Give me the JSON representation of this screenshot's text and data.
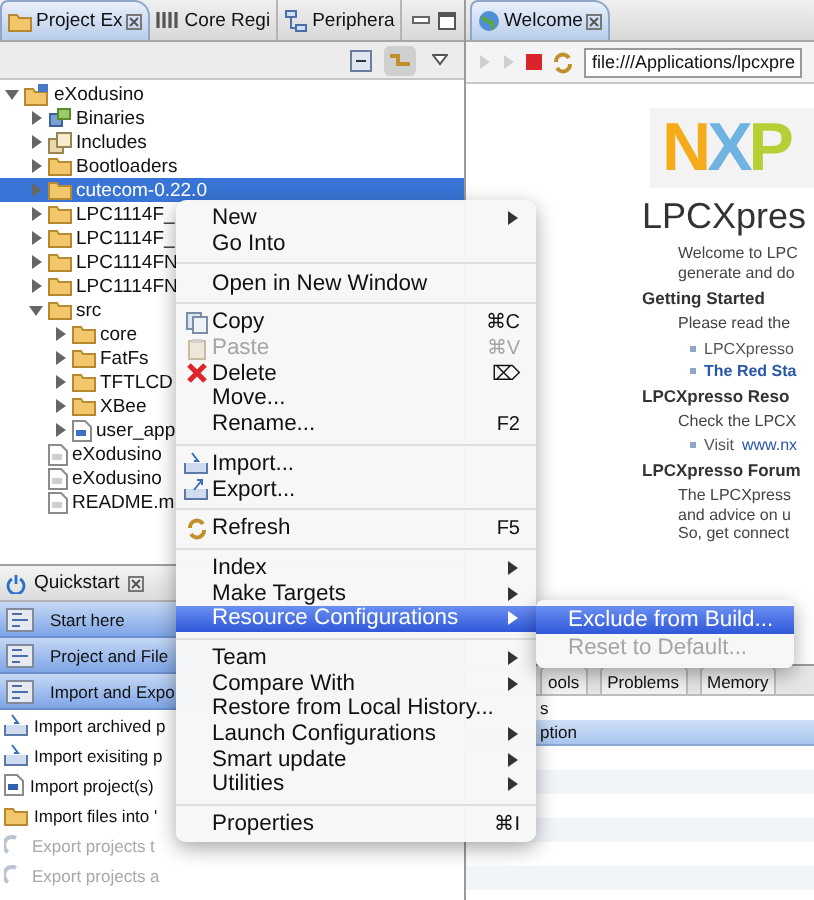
{
  "left_tabs": [
    {
      "label": "Project Ex",
      "selected": true
    },
    {
      "label": "Core Regi",
      "selected": false
    },
    {
      "label": "Periphera",
      "selected": false
    }
  ],
  "tree": [
    {
      "label": "eXodusino",
      "kind": "project",
      "expanded": true,
      "selected": false,
      "children": [
        {
          "label": "Binaries",
          "kind": "binaries",
          "expanded": false,
          "selected": false
        },
        {
          "label": "Includes",
          "kind": "includes",
          "expanded": false,
          "selected": false
        },
        {
          "label": "Bootloaders",
          "kind": "folder",
          "expanded": false,
          "selected": false
        },
        {
          "label": "cutecom-0.22.0",
          "kind": "folder",
          "expanded": false,
          "selected": true
        },
        {
          "label": "LPC1114F_",
          "kind": "folder",
          "expanded": false,
          "selected": false
        },
        {
          "label": "LPC1114F_",
          "kind": "folder",
          "expanded": false,
          "selected": false
        },
        {
          "label": "LPC1114FN",
          "kind": "folder",
          "expanded": false,
          "selected": false
        },
        {
          "label": "LPC1114FN",
          "kind": "folder",
          "expanded": false,
          "selected": false
        },
        {
          "label": "src",
          "kind": "folder",
          "expanded": true,
          "selected": false,
          "children": [
            {
              "label": "core",
              "kind": "folder",
              "expanded": false,
              "selected": false
            },
            {
              "label": "FatFs",
              "kind": "folder",
              "expanded": false,
              "selected": false
            },
            {
              "label": "TFTLCD",
              "kind": "folder",
              "expanded": false,
              "selected": false
            },
            {
              "label": "XBee",
              "kind": "folder",
              "expanded": false,
              "selected": false
            },
            {
              "label": "user_app",
              "kind": "source",
              "expanded": false,
              "selected": false
            }
          ]
        },
        {
          "label": "eXodusino",
          "kind": "file",
          "selected": false
        },
        {
          "label": "eXodusino",
          "kind": "file",
          "selected": false
        },
        {
          "label": "README.m",
          "kind": "file",
          "selected": false
        }
      ]
    }
  ],
  "quickstart": {
    "title": "Quickstart",
    "items": [
      {
        "label": "Start here",
        "kind": "section",
        "disabled": false
      },
      {
        "label": "Project and File",
        "kind": "section",
        "disabled": false
      },
      {
        "label": "Import and Expo",
        "kind": "section",
        "disabled": false
      },
      {
        "label": "Import archived p",
        "kind": "action",
        "disabled": false
      },
      {
        "label": "Import exisiting p",
        "kind": "action",
        "disabled": false
      },
      {
        "label": "Import project(s)",
        "kind": "action",
        "disabled": false
      },
      {
        "label": "Import files into '",
        "kind": "action",
        "disabled": false
      },
      {
        "label": "Export projects t",
        "kind": "action",
        "disabled": true
      },
      {
        "label": "Export projects a",
        "kind": "action",
        "disabled": true
      }
    ]
  },
  "editor": {
    "tab": "Welcome",
    "url": "file:///Applications/lpcxpre",
    "logo": "NXP",
    "title": "LPCXpres",
    "blocks": [
      {
        "kind": "paragraph",
        "lines": [
          "Welcome to LPC",
          "generate and do"
        ]
      },
      {
        "kind": "heading",
        "text": "Getting Started"
      },
      {
        "kind": "paragraph",
        "lines": [
          "Please read the"
        ]
      },
      {
        "kind": "bullet",
        "text": "LPCXpresso"
      },
      {
        "kind": "bullet",
        "link": "The Red Sta"
      },
      {
        "kind": "heading",
        "text": "LPCXpresso Reso"
      },
      {
        "kind": "paragraph",
        "lines": [
          "Check the LPCX"
        ]
      },
      {
        "kind": "bullet",
        "text": "Visit",
        "link": "www.nx"
      },
      {
        "kind": "heading",
        "text": "LPCXpresso Forum"
      },
      {
        "kind": "paragraph",
        "lines": [
          "The LPCXpress",
          "and advice on u",
          "So, get connect"
        ]
      }
    ]
  },
  "bottom_panel": {
    "tabs": [
      {
        "label": "ools",
        "selected": false
      },
      {
        "label": "Problems",
        "selected": false
      },
      {
        "label": "Memory",
        "selected": false
      }
    ],
    "count": "s",
    "column": "ption"
  },
  "context_menu": {
    "items": [
      {
        "kind": "item",
        "label": "New",
        "has_submenu": true,
        "selected": false,
        "disabled": false
      },
      {
        "kind": "item",
        "label": "Go Into",
        "has_submenu": false,
        "selected": false,
        "disabled": false
      },
      {
        "kind": "separator"
      },
      {
        "kind": "item",
        "label": "Open in New Window",
        "has_submenu": false,
        "selected": false,
        "disabled": false
      },
      {
        "kind": "separator"
      },
      {
        "kind": "item",
        "label": "Copy",
        "shortcut": "⌘C",
        "has_submenu": false,
        "selected": false,
        "disabled": false
      },
      {
        "kind": "item",
        "label": "Paste",
        "shortcut": "⌘V",
        "has_submenu": false,
        "selected": false,
        "disabled": true
      },
      {
        "kind": "item",
        "label": "Delete",
        "shortcut": "⌦",
        "has_submenu": false,
        "selected": false,
        "disabled": false
      },
      {
        "kind": "item",
        "label": "Move...",
        "has_submenu": false,
        "selected": false,
        "disabled": false
      },
      {
        "kind": "item",
        "label": "Rename...",
        "shortcut": "F2",
        "has_submenu": false,
        "selected": false,
        "disabled": false
      },
      {
        "kind": "separator"
      },
      {
        "kind": "item",
        "label": "Import...",
        "has_submenu": false,
        "selected": false,
        "disabled": false
      },
      {
        "kind": "item",
        "label": "Export...",
        "has_submenu": false,
        "selected": false,
        "disabled": false
      },
      {
        "kind": "separator"
      },
      {
        "kind": "item",
        "label": "Refresh",
        "shortcut": "F5",
        "has_submenu": false,
        "selected": false,
        "disabled": false
      },
      {
        "kind": "separator"
      },
      {
        "kind": "item",
        "label": "Index",
        "has_submenu": true,
        "selected": false,
        "disabled": false
      },
      {
        "kind": "item",
        "label": "Make Targets",
        "has_submenu": true,
        "selected": false,
        "disabled": false
      },
      {
        "kind": "item",
        "label": "Resource Configurations",
        "has_submenu": true,
        "selected": true,
        "disabled": false,
        "submenu": [
          {
            "label": "Exclude from Build...",
            "selected": true,
            "disabled": false
          },
          {
            "label": "Reset to Default...",
            "selected": false,
            "disabled": true
          }
        ]
      },
      {
        "kind": "separator"
      },
      {
        "kind": "item",
        "label": "Team",
        "has_submenu": true,
        "selected": false,
        "disabled": false
      },
      {
        "kind": "item",
        "label": "Compare With",
        "has_submenu": true,
        "selected": false,
        "disabled": false
      },
      {
        "kind": "item",
        "label": "Restore from Local History...",
        "has_submenu": false,
        "selected": false,
        "disabled": false
      },
      {
        "kind": "item",
        "label": "Launch Configurations",
        "has_submenu": true,
        "selected": false,
        "disabled": false
      },
      {
        "kind": "item",
        "label": "Smart update",
        "has_submenu": true,
        "selected": false,
        "disabled": false
      },
      {
        "kind": "item",
        "label": "Utilities",
        "has_submenu": true,
        "selected": false,
        "disabled": false
      },
      {
        "kind": "separator"
      },
      {
        "kind": "item",
        "label": "Properties",
        "shortcut": "⌘I",
        "has_submenu": false,
        "selected": false,
        "disabled": false
      }
    ]
  }
}
